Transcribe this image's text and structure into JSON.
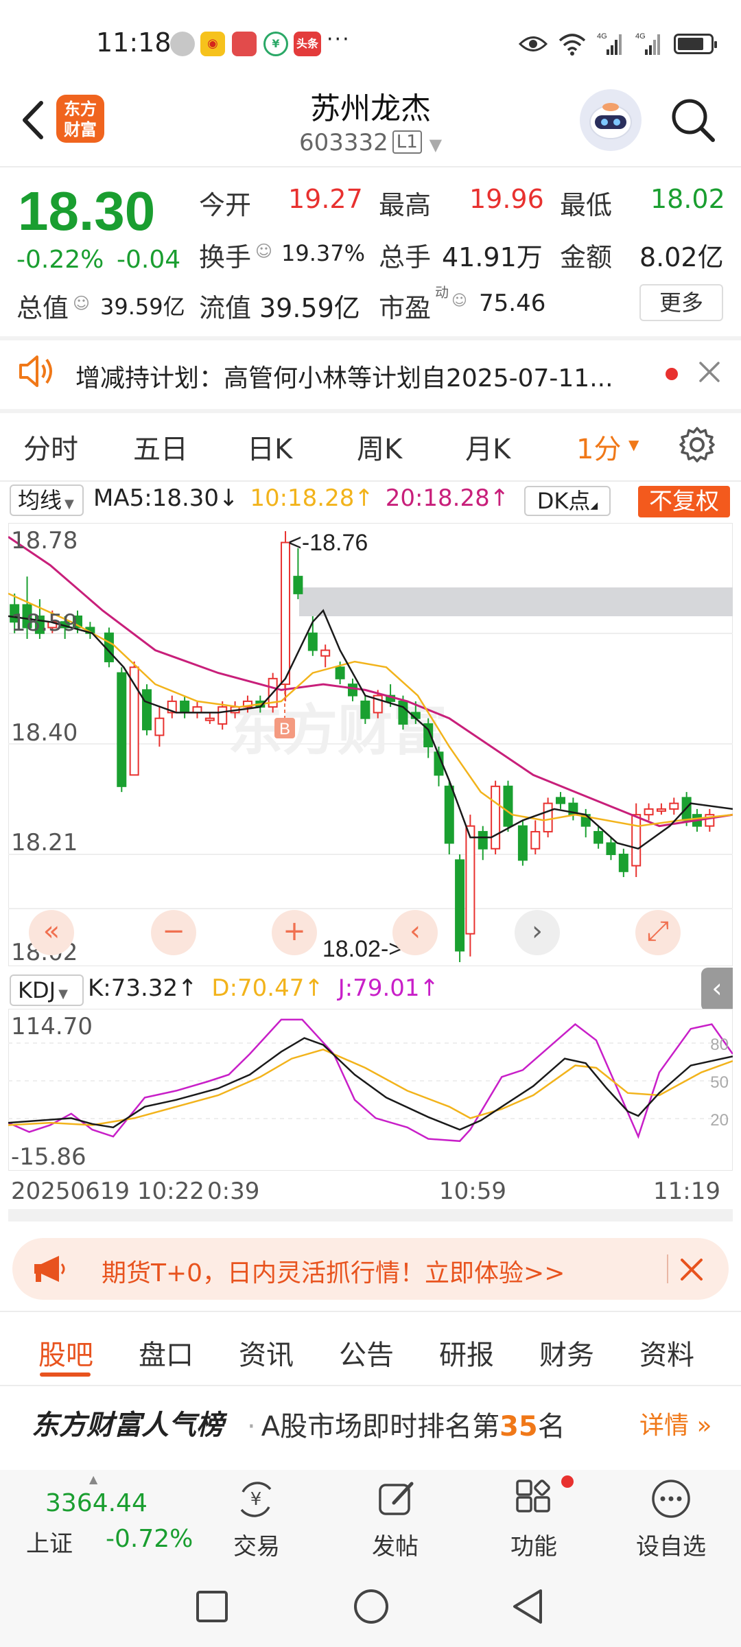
{
  "status_bar": {
    "time": "11:18",
    "overflow_indicator": "···",
    "app_icons": [
      "photo-avatar",
      "weibo",
      "huawei-store",
      "finance-app",
      "toutiao"
    ],
    "toutiao_label": "头条",
    "network": "4G",
    "icons": [
      "eye-icon",
      "wifi-icon",
      "signal-icon",
      "signal-icon",
      "battery-icon"
    ],
    "battery_level": 0.8
  },
  "header": {
    "logo_text_line1": "东方",
    "logo_text_line2": "财富",
    "title": "苏州龙杰",
    "code": "603332",
    "level_badge": "L1"
  },
  "quote": {
    "price": "18.30",
    "change_pct": "-0.22%",
    "change_abs": "-0.04",
    "total_value_label": "总值",
    "total_value": "39.59亿",
    "rows": [
      [
        {
          "label": "今开",
          "value": "19.27"
        },
        {
          "label": "最高",
          "value": "19.96"
        },
        {
          "label": "最低",
          "value": "18.02"
        }
      ],
      [
        {
          "label": "换手",
          "value": "19.37%"
        },
        {
          "label": "总手",
          "value": "41.91万"
        },
        {
          "label": "金额",
          "value": "8.02亿"
        }
      ],
      [
        {
          "label": "流值",
          "value": "39.59亿"
        },
        {
          "label": "市盈",
          "superscript": "动",
          "value": "75.46"
        }
      ]
    ],
    "more_label": "更多",
    "colors": {
      "up": "#e8312f",
      "down": "#1a9e30"
    }
  },
  "notice": {
    "text": "增减持计划：高管何小林等计划自2025-07-11..."
  },
  "period_tabs": [
    "分时",
    "五日",
    "日K",
    "周K",
    "月K",
    "1分"
  ],
  "active_period": "1分",
  "main_chart": {
    "indicator_select": "均线",
    "ma5": "MA5:18.30",
    "ma10": "10:18.28",
    "ma20": "20:18.28",
    "ma5_arrow": "↓",
    "ma10_arrow": "↑",
    "ma20_arrow": "↑",
    "dk_label": "DK点",
    "fq_label": "不复权",
    "y_labels": [
      "18.78",
      "18.59",
      "18.40",
      "18.21",
      "18.02"
    ],
    "high_marker": "<-18.76",
    "low_marker": "18.02->",
    "buy_marker": "B",
    "watermark": "东方财富",
    "colors": {
      "ma5": "#1a1a1a",
      "ma10": "#f2b31b",
      "ma20": "#c81f7a"
    }
  },
  "kdj": {
    "indicator_select": "KDJ",
    "k": "K:73.32",
    "d": "D:70.47",
    "j": "J:79.01",
    "k_arrow": "↑",
    "d_arrow": "↑",
    "j_arrow": "↑",
    "y_max": "114.70",
    "y_min": "-15.86",
    "ref_levels": [
      "80",
      "50",
      "20"
    ]
  },
  "time_axis": [
    "20250619 10:22",
    "0:39",
    "10:59",
    "11:19"
  ],
  "banner": {
    "text": "期货T+0，日内灵活抓行情！立即体验>>"
  },
  "bottom_tabs": [
    "股吧",
    "盘口",
    "资讯",
    "公告",
    "研报",
    "财务",
    "资料"
  ],
  "active_bottom_tab": "股吧",
  "popularity": {
    "title": "东方财富人气榜",
    "text_prefix": "A股市场即时排名第",
    "rank": "35",
    "text_suffix": "名",
    "more": "详情"
  },
  "bottom_nav": {
    "index_value": "3364.44",
    "index_name": "上证",
    "index_change": "-0.72%",
    "items": [
      {
        "label": "交易",
        "icon": "yuan-cycle-icon"
      },
      {
        "label": "发帖",
        "icon": "edit-icon"
      },
      {
        "label": "功能",
        "icon": "grid-icon"
      },
      {
        "label": "设自选",
        "icon": "more-icon"
      }
    ]
  }
}
